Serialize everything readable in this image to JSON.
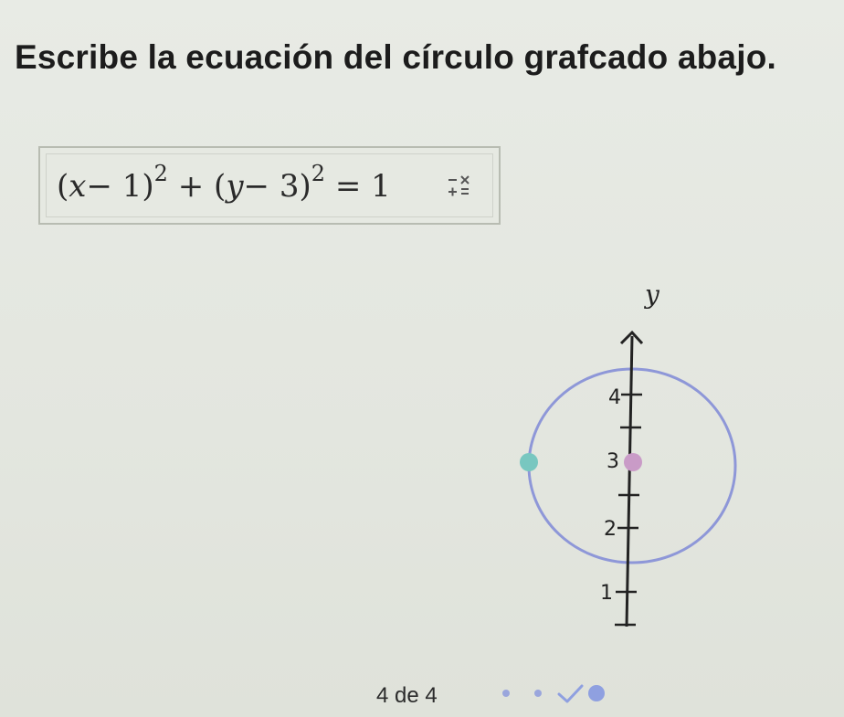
{
  "prompt": {
    "text": "Escribe la ecuación del círculo grafcado abajo."
  },
  "answer": {
    "expr_open1": "(",
    "expr_x": "x",
    "expr_minus1": "− 1",
    "expr_close1": ")",
    "expr_exp1": "2",
    "expr_plus": " + ",
    "expr_open2": "(",
    "expr_y": "y",
    "expr_minus2": "− 3",
    "expr_close2": ")",
    "expr_exp2": "2",
    "expr_eq": " = 1",
    "keypad_icon": "math-keypad-icon"
  },
  "graph": {
    "axis_label": "y",
    "ticks": [
      "4",
      "3",
      "2",
      "1"
    ],
    "circle_color": "#8e97d8",
    "center_point_color": "#c99bc7",
    "left_point_color": "#78c7c0"
  },
  "progress": {
    "text": "4 de 4",
    "dot_color": "#9aa6dc",
    "check_color": "#8fa0e0"
  }
}
